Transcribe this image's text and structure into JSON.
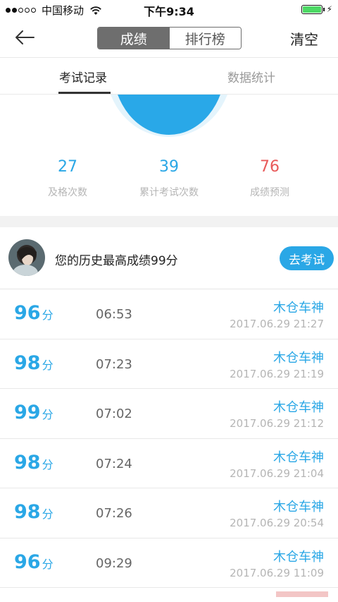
{
  "status_bar": {
    "carrier": "中国移动",
    "time": "下午9:34"
  },
  "nav": {
    "segments": [
      "成绩",
      "排行榜"
    ],
    "clear_label": "清空"
  },
  "tabs": {
    "records": "考试记录",
    "stats": "数据统计"
  },
  "stats": {
    "passed": {
      "value": "27",
      "label": "及格次数",
      "color": "#2aa7e6"
    },
    "total": {
      "value": "39",
      "label": "累计考试次数",
      "color": "#2aa7e6"
    },
    "predicted": {
      "value": "76",
      "label": "成绩预测",
      "color": "#e85a5a"
    }
  },
  "best": {
    "text": "您的历史最高成绩99分",
    "button": "去考试"
  },
  "records": [
    {
      "score": "96",
      "unit": "分",
      "duration": "06:53",
      "name": "木仓车神",
      "date": "2017.06.29 21:27"
    },
    {
      "score": "98",
      "unit": "分",
      "duration": "07:23",
      "name": "木仓车神",
      "date": "2017.06.29 21:19"
    },
    {
      "score": "99",
      "unit": "分",
      "duration": "07:02",
      "name": "木仓车神",
      "date": "2017.06.29 21:12"
    },
    {
      "score": "98",
      "unit": "分",
      "duration": "07:24",
      "name": "木仓车神",
      "date": "2017.06.29 21:04"
    },
    {
      "score": "98",
      "unit": "分",
      "duration": "07:26",
      "name": "木仓车神",
      "date": "2017.06.29 20:54"
    },
    {
      "score": "96",
      "unit": "分",
      "duration": "09:29",
      "name": "木仓车神",
      "date": "2017.06.29 11:09"
    }
  ],
  "colors": {
    "accent": "#2aa7e6",
    "warning": "#e85a5a"
  }
}
